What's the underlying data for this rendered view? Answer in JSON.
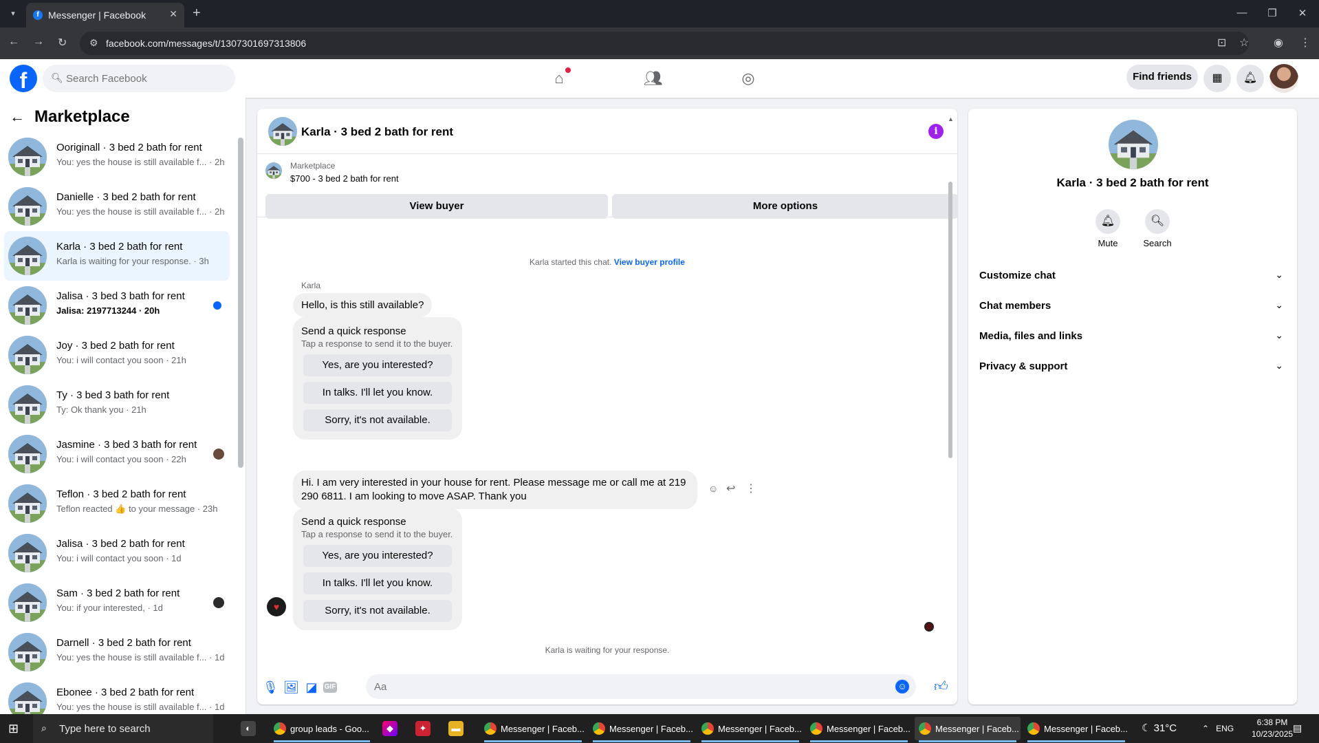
{
  "browser": {
    "tab_title": "Messenger | Facebook",
    "tab_close": "✕",
    "new_tab": "+",
    "url": "facebook.com/messages/t/1307301697313806",
    "window_min": "—",
    "window_max": "❐",
    "window_close": "✕"
  },
  "fb": {
    "logo": "f",
    "search_placeholder": "Search Facebook",
    "find_friends": "Find friends"
  },
  "sidebar": {
    "title": "Marketplace",
    "conversations": [
      {
        "name": "Ooriginall · 3 bed 2 bath for rent",
        "preview": "You: yes the house is still available f... · 2h"
      },
      {
        "name": "Danielle · 3 bed 2 bath for rent",
        "preview": "You: yes the house is still available f... · 2h"
      },
      {
        "name": "Karla · 3 bed 2 bath for rent",
        "preview": "Karla is waiting for your response. · 3h"
      },
      {
        "name": "Jalisa · 3 bed 3 bath for rent",
        "preview": "Jalisa: 2197713244 · 20h"
      },
      {
        "name": "Joy · 3 bed 2 bath for rent",
        "preview": "You: i will contact you soon · 21h"
      },
      {
        "name": "Ty · 3 bed 3 bath for rent",
        "preview": "Ty: Ok thank you · 21h"
      },
      {
        "name": "Jasmine · 3 bed 3 bath for rent",
        "preview": "You: i will contact you soon · 22h"
      },
      {
        "name": "Teflon · 3 bed 2 bath for rent",
        "preview": "Teflon reacted 👍 to your message · 23h"
      },
      {
        "name": "Jalisa · 3 bed 2 bath for rent",
        "preview": "You: i will contact you soon · 1d"
      },
      {
        "name": "Sam · 3 bed 2 bath for rent",
        "preview": "You: if your interested, · 1d"
      },
      {
        "name": "Darnell · 3 bed 2 bath for rent",
        "preview": "You: yes the house is still available f... · 1d"
      },
      {
        "name": "Ebonee · 3 bed 2 bath for rent",
        "preview": "You: yes the house is still available f... · 1d"
      }
    ]
  },
  "chat": {
    "title": "Karla · 3 bed 2 bath for rent",
    "listing_category": "Marketplace",
    "listing_price": "$700 - 3 bed 2 bath for rent",
    "view_buyer": "View buyer",
    "more_options": "More options",
    "started_text": "Karla started this chat.",
    "buyer_profile_link": "View buyer profile",
    "sender_name": "Karla",
    "message1": "Hello, is this still available?",
    "quick_title": "Send a quick response",
    "quick_sub": "Tap a response to send it to the buyer.",
    "quick_options": [
      "Yes, are you interested?",
      "In talks. I'll let you know.",
      "Sorry, it's not available."
    ],
    "message2": "Hi. I am very interested in your house for rent. Please message me or call me at 219 290 6811. I am looking to move ASAP. Thank you",
    "waiting_text": "Karla is waiting for your response.",
    "input_placeholder": "Aa",
    "gif_label": "GIF"
  },
  "details": {
    "title": "Karla · 3 bed 2 bath for rent",
    "mute": "Mute",
    "search": "Search",
    "sections": [
      "Customize chat",
      "Chat members",
      "Media, files and links",
      "Privacy & support"
    ]
  },
  "taskbar": {
    "search_placeholder": "Type here to search",
    "apps": [
      "group leads - Goo...",
      "Messenger | Faceb...",
      "Messenger | Faceb...",
      "Messenger | Faceb...",
      "Messenger | Faceb...",
      "Messenger | Faceb...",
      "Messenger | Faceb..."
    ],
    "temperature": "31°C",
    "language": "ENG",
    "time": "6:38 PM",
    "date": "10/23/2025"
  },
  "colors": {
    "fb_blue": "#0866ff",
    "selected_row": "#ebf5ff",
    "info_icon": "#a020f0"
  },
  "icons": [
    "search-icon",
    "home-icon",
    "friends-icon",
    "groups-icon",
    "apps-grid-icon",
    "bell-icon",
    "back-arrow-icon",
    "info-icon",
    "mic-icon",
    "photo-icon",
    "sticker-icon",
    "gif-icon",
    "emoji-icon",
    "like-icon",
    "chevron-down-icon"
  ]
}
